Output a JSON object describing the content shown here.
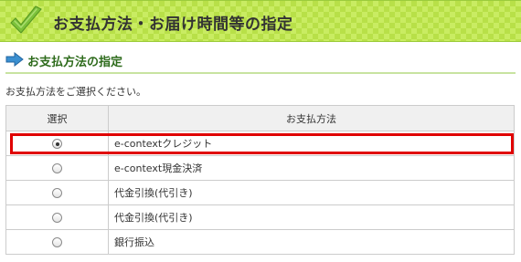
{
  "banner": {
    "title": "お支払方法・お届け時間等の指定",
    "colors": {
      "background": "#c9ec62",
      "check": "#7cc23a"
    }
  },
  "section": {
    "title": "お支払方法の指定",
    "title_color": "#2e6b1c"
  },
  "instruction": "お支払方法をご選択ください。",
  "table": {
    "headers": {
      "select": "選択",
      "method": "お支払方法"
    },
    "rows": [
      {
        "label": "e-contextクレジット",
        "selected": true
      },
      {
        "label": "e-context現金決済",
        "selected": false
      },
      {
        "label": "代金引換(代引き)",
        "selected": false
      },
      {
        "label": "代金引換(代引き)",
        "selected": false
      },
      {
        "label": "銀行振込",
        "selected": false
      }
    ]
  },
  "highlight_color": "#e00000"
}
